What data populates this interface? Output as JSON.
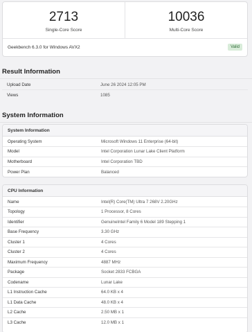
{
  "scores": {
    "single": {
      "value": "2713",
      "label": "Single-Core Score"
    },
    "multi": {
      "value": "10036",
      "label": "Multi-Core Score"
    },
    "version": "Geekbench 6.3.0 for Windows AVX2",
    "valid": "Valid"
  },
  "result_info": {
    "title": "Result Information",
    "rows": [
      {
        "k": "Upload Date",
        "v": "June 26 2024 12:05 PM"
      },
      {
        "k": "Views",
        "v": "1085"
      }
    ]
  },
  "system_info": {
    "title": "System Information",
    "system": {
      "header": "System Information",
      "rows": [
        {
          "k": "Operating System",
          "v": "Microsoft Windows 11 Enterprise (64-bit)"
        },
        {
          "k": "Model",
          "v": "Intel Corporation Lunar Lake Client Platform"
        },
        {
          "k": "Motherboard",
          "v": "Intel Corporation TBD"
        },
        {
          "k": "Power Plan",
          "v": "Balanced"
        }
      ]
    },
    "cpu": {
      "header": "CPU Information",
      "rows": [
        {
          "k": "Name",
          "v": "Intel(R) Core(TM) Ultra 7 268V 2.20GHz"
        },
        {
          "k": "Topology",
          "v": "1 Processor, 8 Cores"
        },
        {
          "k": "Identifier",
          "v": "GenuineIntel Family 6 Model 189 Stepping 1"
        },
        {
          "k": "Base Frequency",
          "v": "3.30 GHz"
        },
        {
          "k": "Cluster 1",
          "v": "4 Cores"
        },
        {
          "k": "Cluster 2",
          "v": "4 Cores"
        },
        {
          "k": "Maximum Frequency",
          "v": "4887 MHz"
        },
        {
          "k": "Package",
          "v": "Socket 2833 FCBGA"
        },
        {
          "k": "Codename",
          "v": "Lunar Lake"
        },
        {
          "k": "L1 Instruction Cache",
          "v": "64.0 KB x 4"
        },
        {
          "k": "L1 Data Cache",
          "v": "48.0 KB x 4"
        },
        {
          "k": "L2 Cache",
          "v": "2.50 MB x 1"
        },
        {
          "k": "L3 Cache",
          "v": "12.0 MB x 1"
        }
      ]
    }
  }
}
